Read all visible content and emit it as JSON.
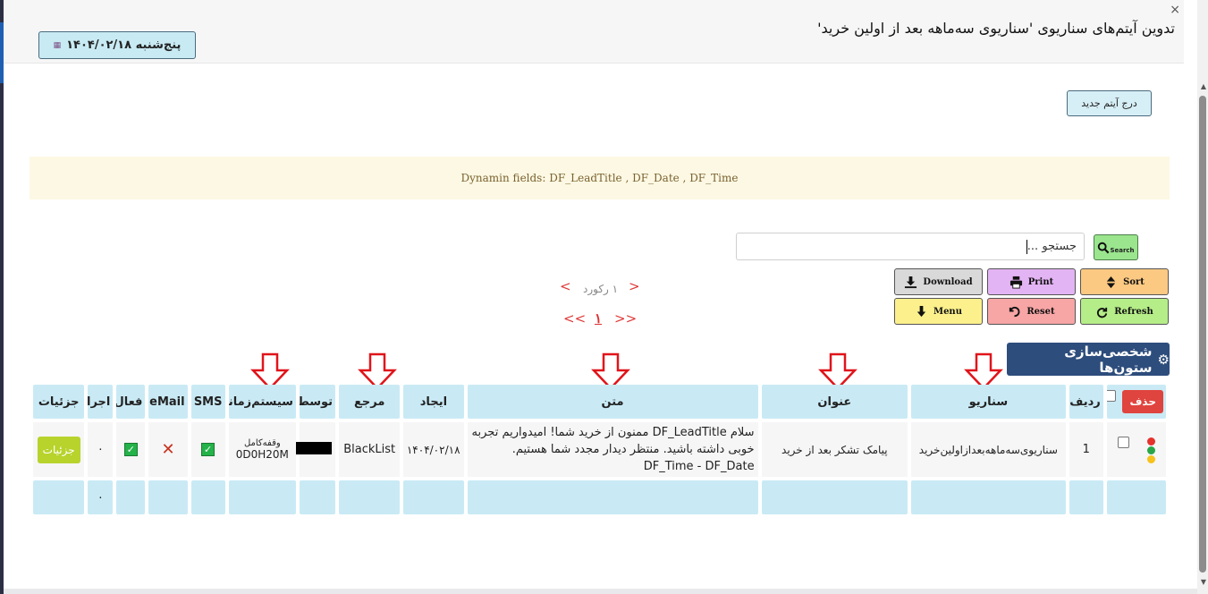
{
  "header": {
    "title": "تدوین آیتم‌های سناریوی 'سناریوی سه‌ماهه بعد از اولین خرید'",
    "date_label": "پنج‌شنبه ۱۴۰۴/۰۲/۱۸"
  },
  "toolbar": {
    "new_item_label": "درج آیتم جدید",
    "dynamic_fields": "Dynamin fields: DF_LeadTitle , DF_Date , DF_Time",
    "search_placeholder": "جستجو ...",
    "search_btn_label": "Search",
    "download_label": "Download",
    "print_label": "Print",
    "sort_label": "Sort",
    "menu_label": "Menu",
    "reset_label": "Reset",
    "refresh_label": "Refresh",
    "custom_columns_label": "شخصی‌سازی ستون‌ها"
  },
  "pager": {
    "record_count": "۱ رکورد",
    "prev": "<",
    "next": ">",
    "first": "<<",
    "last": ">>",
    "current_page": "۱"
  },
  "table": {
    "headers": {
      "delete": "حذف",
      "row": "ردیف",
      "scenario": "سناریو",
      "title": "عنوان",
      "text": "متن",
      "created": "ایجاد",
      "source": "مرجع",
      "by": "توسط",
      "system_time": "سیستم‌زمانی",
      "sms": "SMS",
      "email": "eMail",
      "active": "فعال",
      "run": "اجرا",
      "details": "جزئیات"
    },
    "rows": [
      {
        "row": "1",
        "scenario": "سناریوی‌سه‌ماهه‌بعدازاولین‌خرید",
        "title": "پیامک تشکر بعد از خرید",
        "text": "سلام DF_LeadTitle ممنون از خرید شما! امیدواریم تجربه خوبی داشته باشید. منتظر دیدار مجدد شما هستیم. DF_Time - DF_Date",
        "created": "۱۴۰۴/۰۲/۱۸",
        "source": "BlackList",
        "system_time_label": "وقفه‌کامل",
        "system_time_value": "0D0H20M",
        "run": "۰",
        "details_label": "جزئیات"
      }
    ],
    "footer_run": "۰"
  }
}
